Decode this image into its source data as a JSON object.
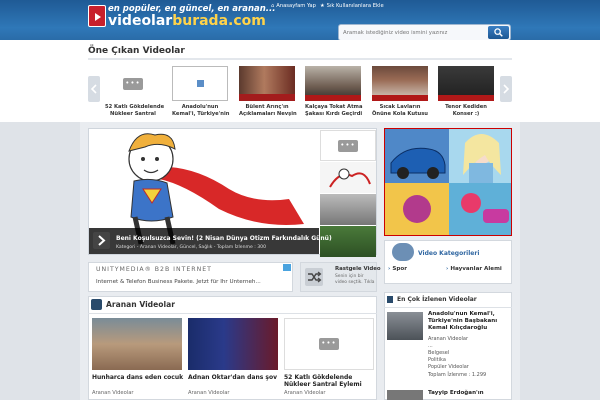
{
  "header": {
    "tagline": "en popüler, en güncel, en aranan...",
    "logo_part1": "videolar",
    "logo_part2": "burada.com",
    "link_home": "Anasayfam Yap",
    "link_fav": "Sık Kullanılanlara Ekle",
    "search_placeholder": "Aramak istediğiniz video ismini yazınız",
    "search_icon": "magnifier-icon"
  },
  "featured": {
    "title": "Öne Çıkan Videolar",
    "items": [
      {
        "caption": "52 Katlı Gökdelende",
        "caption2": "Nükleer Santral"
      },
      {
        "caption": "Anadolu'nun",
        "caption2": "Kemal'i, Türkiye'nin"
      },
      {
        "caption": "Bülent Arınç'ın",
        "caption2": "Açıklamaları Nevşin"
      },
      {
        "caption": "Kalçaya Tokat Atma",
        "caption2": "Şakası Kırdı Geçirdi"
      },
      {
        "caption": "Sıcak Lavların",
        "caption2": "Önüne Kola Kutusu"
      },
      {
        "caption": "Tenor Kediden",
        "caption2": "Konser :)"
      }
    ]
  },
  "hero": {
    "title": "Beni Koşulsuzca Sevin! (2 Nisan Dünya Otizm Farkındalık Günü)",
    "meta": "Kategori - Aranan Videolar, Güncel, Sağlık - Toplam İzlenme : 300"
  },
  "banner": {
    "title": "UNITYMEDIA® B2B INTERNET",
    "text": "Internet & Telefon Business Pakete. Jetzt für Ihr Unterneh..."
  },
  "random": {
    "title": "Rastgele Video",
    "desc1": "Senin için bir",
    "desc2": "video seçtik. Tıkla"
  },
  "categories": {
    "title": "Video Kategorileri",
    "items": [
      "Spor",
      "Hayvanlar Alemi"
    ]
  },
  "searched": {
    "title": "Aranan Videolar",
    "items": [
      {
        "title": "Hunharca dans eden cocuk",
        "title2": "",
        "category": "Aranan Videolar"
      },
      {
        "title": "Adnan Oktar'dan dans şov",
        "title2": "",
        "category": "Aranan Videolar"
      },
      {
        "title": "52 Katlı Gökdelende",
        "title2": "Nükleer Santral Eylemi",
        "category": "Aranan Videolar"
      }
    ]
  },
  "most_watched": {
    "title": "En Çok İzlenen Videolar",
    "item": {
      "title1": "Anadolu'nun Kemal'i,",
      "title2": "Türkiye'nin Başbakanı",
      "title3": "Kemal Kılıçdaroğlu",
      "cat1": "Aranan Videolar",
      "cat2": "...",
      "cat3": "Belgesel",
      "cat4": "Politika",
      "cat5": "Popüler Videolar",
      "views": "Toplam İzlenme : 1.299"
    },
    "next_title": "Tayyip Erdoğan'ın"
  }
}
